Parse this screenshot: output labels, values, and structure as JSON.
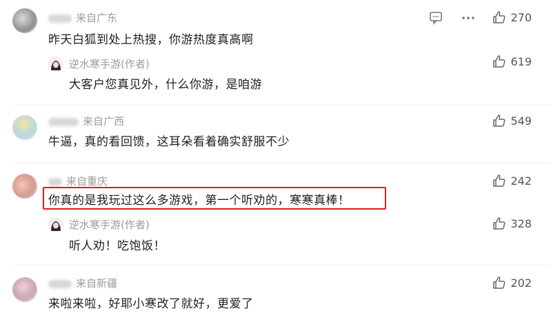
{
  "comments": [
    {
      "type": "comment",
      "location": "来自广东",
      "text": "昨天白狐到处上热搜，你游热度真高啊",
      "likes": "270"
    },
    {
      "type": "reply",
      "author": "逆水寒手游(作者)",
      "text": "大客户您真见外，什么你游，是咱游",
      "likes": "619"
    },
    {
      "type": "comment",
      "location": "来自广西",
      "text": "牛逼，真的看回馈，这耳朵看着确实舒服不少",
      "likes": "549"
    },
    {
      "type": "comment",
      "location": "来自重庆",
      "text": "你真的是我玩过这么多游戏，第一个听劝的，寒寒真棒！",
      "likes": "242"
    },
    {
      "type": "reply",
      "author": "逆水寒手游(作者)",
      "text": "听人劝！吃饱饭！",
      "likes": "328"
    },
    {
      "type": "comment",
      "location": "来自新疆",
      "text": "来啦来啦，好耶小寒改了就好，更爱了",
      "likes": "202"
    }
  ],
  "icons": {
    "comment": "comment-icon",
    "share": "share-icon",
    "like": "thumbs-up-icon"
  },
  "colors": {
    "highlight": "#e01b1b",
    "meta": "#9b9b9b",
    "text": "#1f1f1f"
  }
}
